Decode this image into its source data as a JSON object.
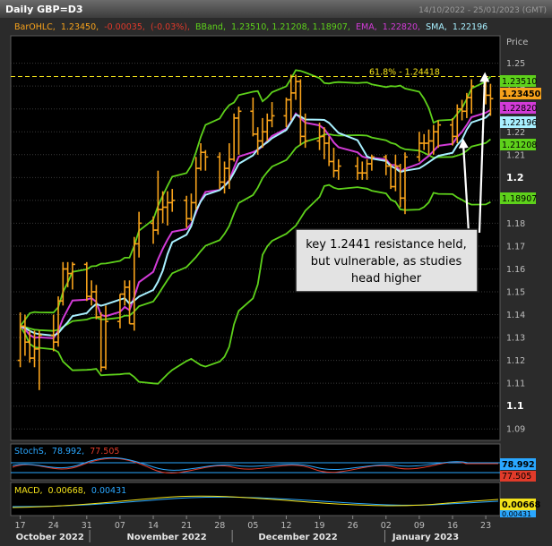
{
  "header": {
    "title": "Daily GBP=D3",
    "date_range": "14/10/2022 - 25/01/2023 (GMT)"
  },
  "legend": {
    "bar_name": "BarOHLC,",
    "bar_close": "1.23450,",
    "bar_change": "-0.00035,",
    "bar_pct": "(-0.03%),",
    "bband_name": "BBand,",
    "bband_values": "1.23510, 1.21208, 1.18907,",
    "ema_name": "EMA,",
    "ema_value": "1.22820,",
    "sma_name": "SMA,",
    "sma_value": "1.22196"
  },
  "price_axis_title": "Price",
  "fib": {
    "label": "61.8% - 1.24418",
    "value": 1.24418
  },
  "annotation": {
    "line1": "key 1.2441 resistance held,",
    "line2": "but vulnerable, as studies",
    "line3": "head higher"
  },
  "price_tags": {
    "bb_upper": "1.23510",
    "close": "1.23450",
    "ema": "1.22820",
    "sma": "1.22196",
    "bb_mid": "1.21208",
    "bb_lower": "1.18907"
  },
  "stoch": {
    "name": "StochS,",
    "k": "78.992,",
    "d": "77.505",
    "k_tag": "78.992",
    "d_tag": "77.505"
  },
  "macd": {
    "name": "MACD,",
    "value": "0.00668,",
    "signal": "0.00431",
    "value_tag": "0.00668",
    "signal_tag": "0.00431"
  },
  "x_day_labels": [
    "17",
    "24",
    "31",
    "07",
    "14",
    "21",
    "28",
    "05",
    "12",
    "19",
    "26",
    "02",
    "09",
    "16",
    "23"
  ],
  "x_month_labels": [
    "October 2022",
    "November 2022",
    "December 2022",
    "January 2023"
  ],
  "colors": {
    "bars": "#f7a21b",
    "bband": "#5ed11b",
    "ema": "#d23bd7",
    "sma": "#a8f0ff",
    "fib": "#f3e21a",
    "stoch_k": "#2aa7ff",
    "stoch_d": "#e03b2a",
    "macd": "#f3e21a",
    "macd_signal": "#2aa7ff"
  },
  "chart_data": {
    "type": "ohlc",
    "y_ticks": [
      "1.25",
      "1.24",
      "1.23",
      "1.22",
      "1.21",
      "1.2",
      "1.19",
      "1.18",
      "1.17",
      "1.16",
      "1.15",
      "1.14",
      "1.13",
      "1.12",
      "1.11",
      "1.1",
      "1.09"
    ],
    "ylim": [
      1.085,
      1.262
    ],
    "bars": [
      {
        "date": "2022-10-17",
        "o": 1.12,
        "h": 1.141,
        "l": 1.117,
        "c": 1.135
      },
      {
        "date": "2022-10-18",
        "o": 1.135,
        "h": 1.14,
        "l": 1.122,
        "c": 1.128
      },
      {
        "date": "2022-10-19",
        "o": 1.128,
        "h": 1.133,
        "l": 1.119,
        "c": 1.121
      },
      {
        "date": "2022-10-20",
        "o": 1.121,
        "h": 1.133,
        "l": 1.117,
        "c": 1.125
      },
      {
        "date": "2022-10-21",
        "o": 1.125,
        "h": 1.133,
        "l": 1.107,
        "c": 1.131
      },
      {
        "date": "2022-10-24",
        "o": 1.131,
        "h": 1.14,
        "l": 1.124,
        "c": 1.128
      },
      {
        "date": "2022-10-25",
        "o": 1.128,
        "h": 1.148,
        "l": 1.126,
        "c": 1.146
      },
      {
        "date": "2022-10-26",
        "o": 1.146,
        "h": 1.163,
        "l": 1.144,
        "c": 1.16
      },
      {
        "date": "2022-10-27",
        "o": 1.16,
        "h": 1.163,
        "l": 1.152,
        "c": 1.158
      },
      {
        "date": "2022-10-28",
        "o": 1.158,
        "h": 1.163,
        "l": 1.151,
        "c": 1.162
      },
      {
        "date": "2022-10-31",
        "o": 1.162,
        "h": 1.163,
        "l": 1.146,
        "c": 1.148
      },
      {
        "date": "2022-11-01",
        "o": 1.148,
        "h": 1.155,
        "l": 1.144,
        "c": 1.15
      },
      {
        "date": "2022-11-02",
        "o": 1.15,
        "h": 1.153,
        "l": 1.138,
        "c": 1.139
      },
      {
        "date": "2022-11-03",
        "o": 1.139,
        "h": 1.141,
        "l": 1.115,
        "c": 1.117
      },
      {
        "date": "2022-11-04",
        "o": 1.117,
        "h": 1.144,
        "l": 1.116,
        "c": 1.137
      },
      {
        "date": "2022-11-07",
        "o": 1.137,
        "h": 1.149,
        "l": 1.134,
        "c": 1.149
      },
      {
        "date": "2022-11-08",
        "o": 1.149,
        "h": 1.155,
        "l": 1.144,
        "c": 1.152
      },
      {
        "date": "2022-11-09",
        "o": 1.152,
        "h": 1.155,
        "l": 1.136,
        "c": 1.136
      },
      {
        "date": "2022-11-10",
        "o": 1.136,
        "h": 1.174,
        "l": 1.133,
        "c": 1.171
      },
      {
        "date": "2022-11-11",
        "o": 1.171,
        "h": 1.185,
        "l": 1.165,
        "c": 1.18
      },
      {
        "date": "2022-11-14",
        "o": 1.18,
        "h": 1.183,
        "l": 1.171,
        "c": 1.177
      },
      {
        "date": "2022-11-15",
        "o": 1.177,
        "h": 1.203,
        "l": 1.175,
        "c": 1.186
      },
      {
        "date": "2022-11-16",
        "o": 1.186,
        "h": 1.194,
        "l": 1.18,
        "c": 1.187
      },
      {
        "date": "2022-11-17",
        "o": 1.187,
        "h": 1.194,
        "l": 1.179,
        "c": 1.189
      },
      {
        "date": "2022-11-18",
        "o": 1.189,
        "h": 1.195,
        "l": 1.185,
        "c": 1.19
      },
      {
        "date": "2022-11-21",
        "o": 1.19,
        "h": 1.192,
        "l": 1.178,
        "c": 1.182
      },
      {
        "date": "2022-11-22",
        "o": 1.182,
        "h": 1.193,
        "l": 1.181,
        "c": 1.189
      },
      {
        "date": "2022-11-23",
        "o": 1.189,
        "h": 1.209,
        "l": 1.186,
        "c": 1.204
      },
      {
        "date": "2022-11-24",
        "o": 1.204,
        "h": 1.215,
        "l": 1.203,
        "c": 1.211
      },
      {
        "date": "2022-11-25",
        "o": 1.211,
        "h": 1.212,
        "l": 1.203,
        "c": 1.209
      },
      {
        "date": "2022-11-28",
        "o": 1.209,
        "h": 1.211,
        "l": 1.195,
        "c": 1.198
      },
      {
        "date": "2022-11-29",
        "o": 1.198,
        "h": 1.207,
        "l": 1.193,
        "c": 1.204
      },
      {
        "date": "2022-11-30",
        "o": 1.204,
        "h": 1.215,
        "l": 1.195,
        "c": 1.208
      },
      {
        "date": "2022-12-01",
        "o": 1.208,
        "h": 1.228,
        "l": 1.207,
        "c": 1.226
      },
      {
        "date": "2022-12-02",
        "o": 1.226,
        "h": 1.231,
        "l": 1.21,
        "c": 1.229
      },
      {
        "date": "2022-12-05",
        "o": 1.229,
        "h": 1.235,
        "l": 1.218,
        "c": 1.219
      },
      {
        "date": "2022-12-06",
        "o": 1.219,
        "h": 1.222,
        "l": 1.21,
        "c": 1.216
      },
      {
        "date": "2022-12-07",
        "o": 1.216,
        "h": 1.226,
        "l": 1.213,
        "c": 1.22
      },
      {
        "date": "2022-12-08",
        "o": 1.22,
        "h": 1.228,
        "l": 1.216,
        "c": 1.225
      },
      {
        "date": "2022-12-09",
        "o": 1.225,
        "h": 1.233,
        "l": 1.222,
        "c": 1.227
      },
      {
        "date": "2022-12-12",
        "o": 1.227,
        "h": 1.235,
        "l": 1.222,
        "c": 1.234
      },
      {
        "date": "2022-12-13",
        "o": 1.234,
        "h": 1.245,
        "l": 1.225,
        "c": 1.237
      },
      {
        "date": "2022-12-14",
        "o": 1.237,
        "h": 1.245,
        "l": 1.234,
        "c": 1.242
      },
      {
        "date": "2022-12-15",
        "o": 1.242,
        "h": 1.243,
        "l": 1.214,
        "c": 1.218
      },
      {
        "date": "2022-12-16",
        "o": 1.218,
        "h": 1.228,
        "l": 1.213,
        "c": 1.216
      },
      {
        "date": "2022-12-19",
        "o": 1.216,
        "h": 1.224,
        "l": 1.212,
        "c": 1.218
      },
      {
        "date": "2022-12-20",
        "o": 1.218,
        "h": 1.222,
        "l": 1.208,
        "c": 1.215
      },
      {
        "date": "2022-12-21",
        "o": 1.215,
        "h": 1.218,
        "l": 1.205,
        "c": 1.207
      },
      {
        "date": "2022-12-22",
        "o": 1.207,
        "h": 1.213,
        "l": 1.2,
        "c": 1.203
      },
      {
        "date": "2022-12-23",
        "o": 1.203,
        "h": 1.208,
        "l": 1.199,
        "c": 1.205
      },
      {
        "date": "2022-12-27",
        "o": 1.205,
        "h": 1.209,
        "l": 1.199,
        "c": 1.202
      },
      {
        "date": "2022-12-28",
        "o": 1.202,
        "h": 1.207,
        "l": 1.199,
        "c": 1.202
      },
      {
        "date": "2022-12-29",
        "o": 1.202,
        "h": 1.208,
        "l": 1.199,
        "c": 1.206
      },
      {
        "date": "2022-12-30",
        "o": 1.206,
        "h": 1.21,
        "l": 1.203,
        "c": 1.209
      },
      {
        "date": "2023-01-02",
        "o": 1.209,
        "h": 1.21,
        "l": 1.201,
        "c": 1.205
      },
      {
        "date": "2023-01-03",
        "o": 1.205,
        "h": 1.206,
        "l": 1.195,
        "c": 1.196
      },
      {
        "date": "2023-01-04",
        "o": 1.196,
        "h": 1.21,
        "l": 1.194,
        "c": 1.205
      },
      {
        "date": "2023-01-05",
        "o": 1.205,
        "h": 1.206,
        "l": 1.187,
        "c": 1.191
      },
      {
        "date": "2023-01-06",
        "o": 1.191,
        "h": 1.211,
        "l": 1.184,
        "c": 1.209
      },
      {
        "date": "2023-01-09",
        "o": 1.209,
        "h": 1.22,
        "l": 1.207,
        "c": 1.215
      },
      {
        "date": "2023-01-10",
        "o": 1.215,
        "h": 1.219,
        "l": 1.212,
        "c": 1.215
      },
      {
        "date": "2023-01-11",
        "o": 1.215,
        "h": 1.221,
        "l": 1.21,
        "c": 1.216
      },
      {
        "date": "2023-01-12",
        "o": 1.216,
        "h": 1.223,
        "l": 1.21,
        "c": 1.22
      },
      {
        "date": "2023-01-13",
        "o": 1.22,
        "h": 1.225,
        "l": 1.213,
        "c": 1.223
      },
      {
        "date": "2023-01-16",
        "o": 1.223,
        "h": 1.226,
        "l": 1.214,
        "c": 1.218
      },
      {
        "date": "2023-01-17",
        "o": 1.218,
        "h": 1.232,
        "l": 1.215,
        "c": 1.23
      },
      {
        "date": "2023-01-18",
        "o": 1.23,
        "h": 1.234,
        "l": 1.225,
        "c": 1.229
      },
      {
        "date": "2023-01-19",
        "o": 1.229,
        "h": 1.237,
        "l": 1.226,
        "c": 1.235
      },
      {
        "date": "2023-01-20",
        "o": 1.235,
        "h": 1.243,
        "l": 1.228,
        "c": 1.24
      },
      {
        "date": "2023-01-23",
        "o": 1.24,
        "h": 1.242,
        "l": 1.232,
        "c": 1.236
      },
      {
        "date": "2023-01-24",
        "o": 1.236,
        "h": 1.241,
        "l": 1.227,
        "c": 1.2345
      }
    ]
  }
}
